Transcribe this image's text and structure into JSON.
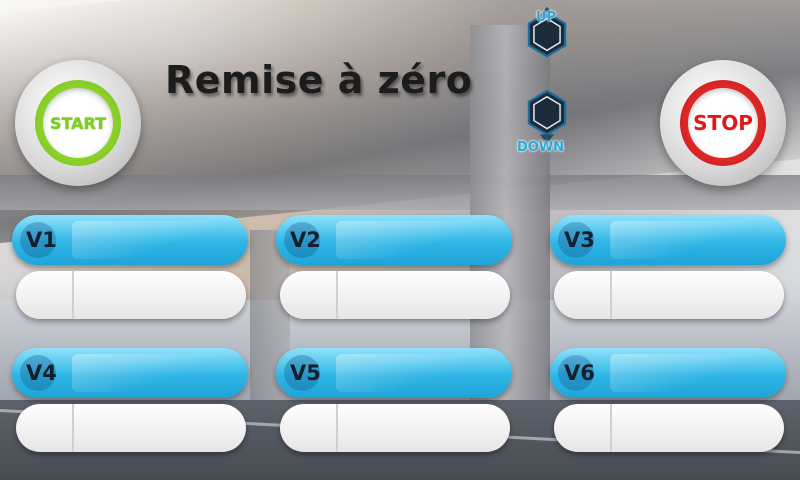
{
  "title": "Remise à zéro",
  "buttons": {
    "start_label": "START",
    "stop_label": "STOP",
    "up_label": "UP",
    "down_label": "DOWN"
  },
  "colors": {
    "start_ring": "#7cd11c",
    "stop_ring": "#e01818",
    "card_accent": "#2fb6e6"
  },
  "icons": {
    "up": "hexagon-up-arrow-icon",
    "down": "hexagon-down-arrow-icon"
  },
  "cards": [
    {
      "label": "V1",
      "value": ""
    },
    {
      "label": "V2",
      "value": ""
    },
    {
      "label": "V3",
      "value": ""
    },
    {
      "label": "V4",
      "value": ""
    },
    {
      "label": "V5",
      "value": ""
    },
    {
      "label": "V6",
      "value": ""
    }
  ]
}
